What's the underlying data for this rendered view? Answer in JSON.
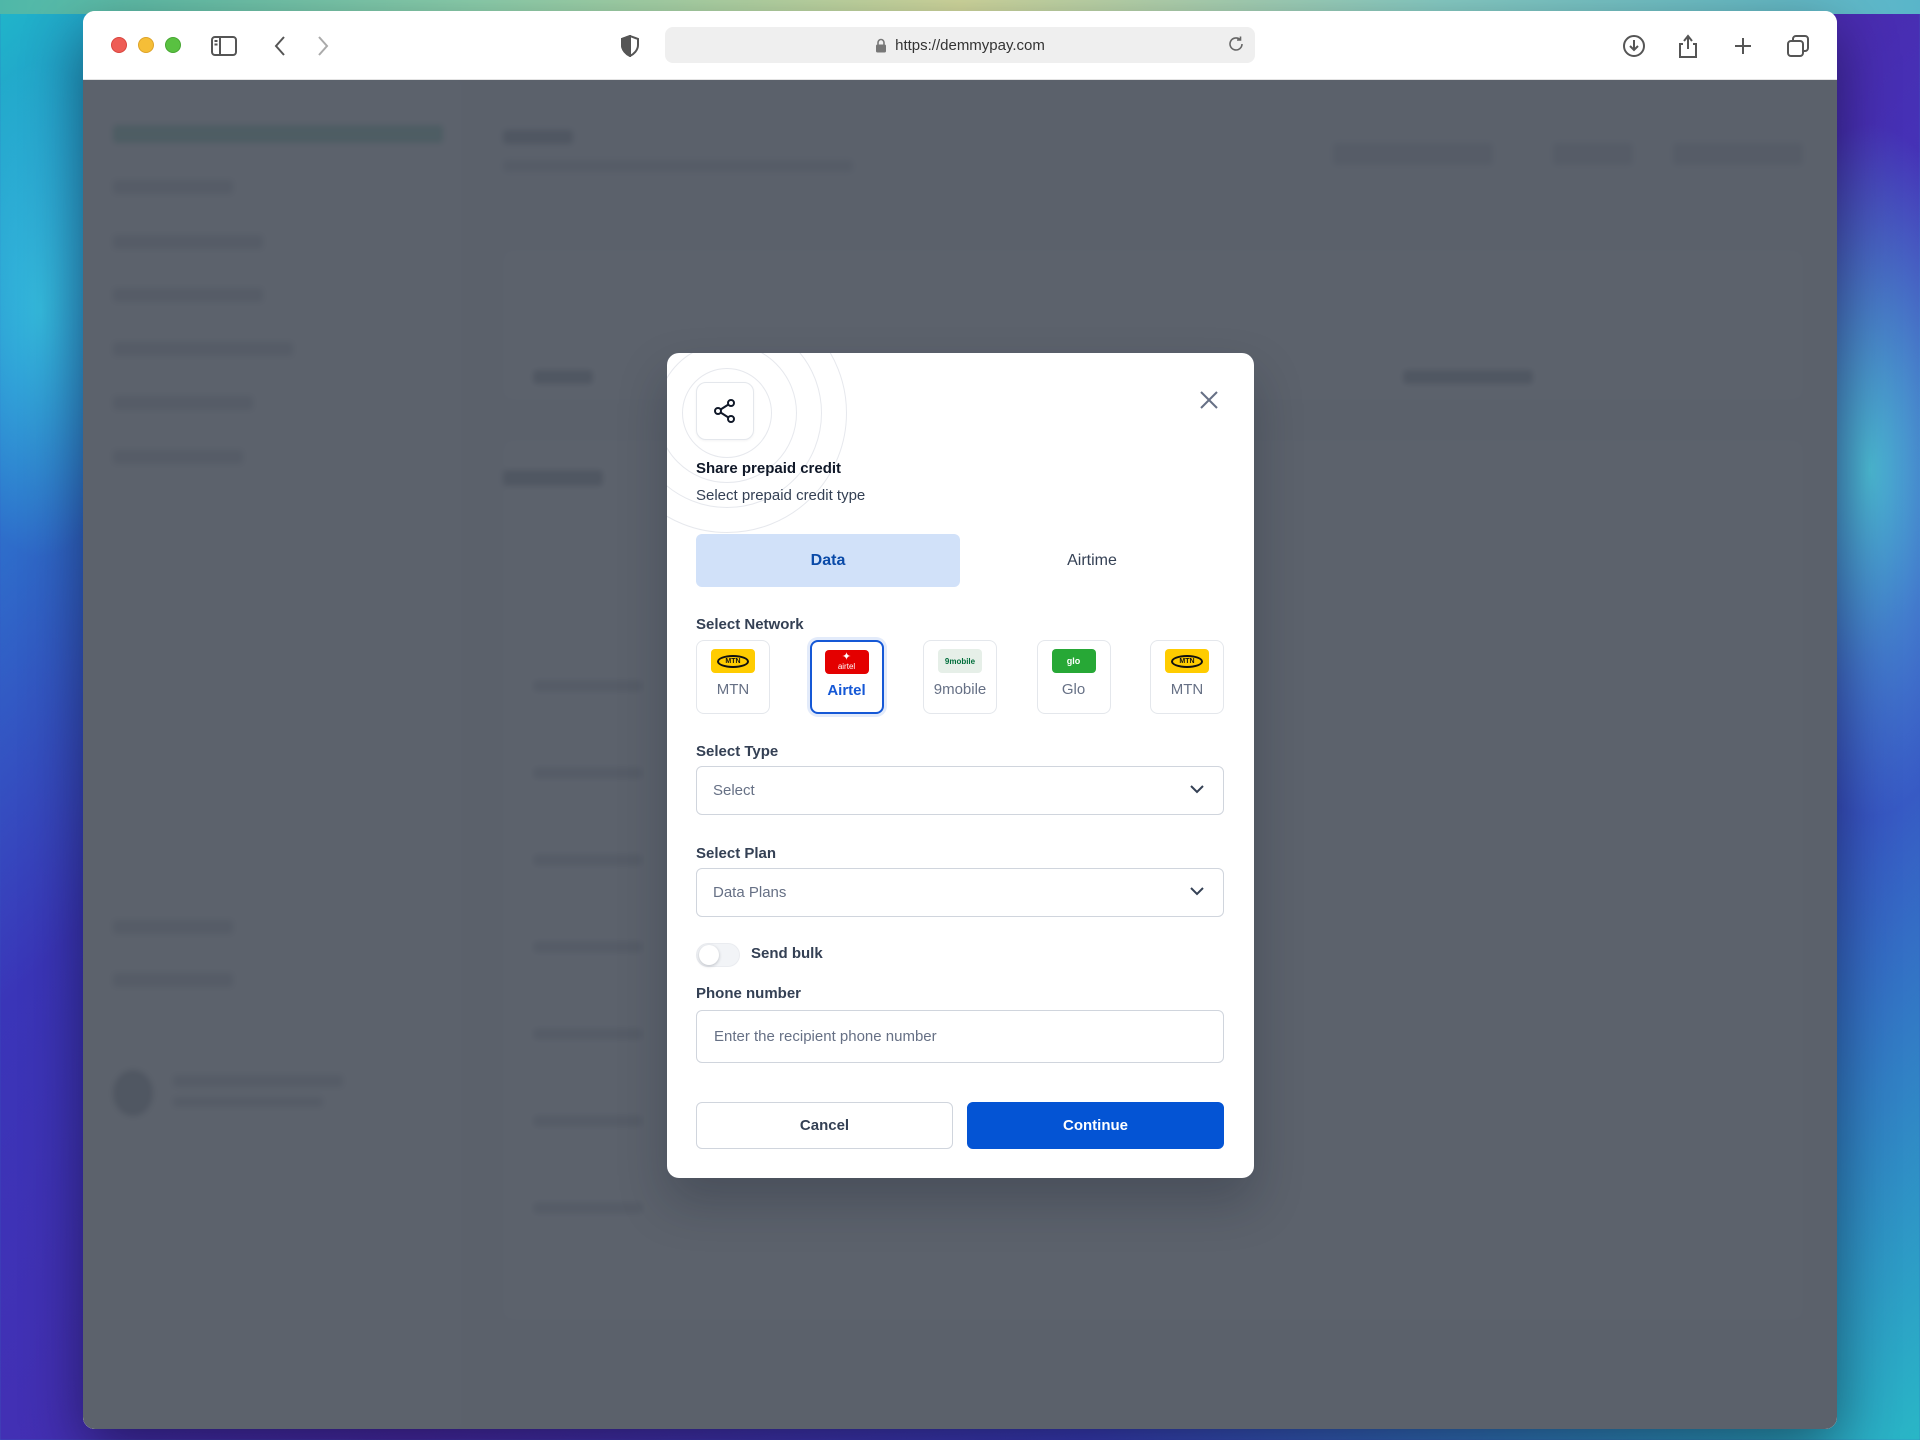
{
  "browser": {
    "url": "https://demmypay.com"
  },
  "modal": {
    "title": "Share prepaid credit",
    "subtitle": "Select prepaid credit type",
    "credit_types": [
      {
        "label": "Data",
        "active": true
      },
      {
        "label": "Airtime",
        "active": false
      }
    ],
    "network_label": "Select Network",
    "networks": [
      {
        "name": "MTN",
        "logo_text": "MTN",
        "color": "#ffcc00",
        "selected": false
      },
      {
        "name": "Airtel",
        "logo_text": "airtel",
        "color": "#e40000",
        "selected": true
      },
      {
        "name": "9mobile",
        "logo_text": "9mobile",
        "color": "#006e3b",
        "selected": false
      },
      {
        "name": "Glo",
        "logo_text": "glo",
        "color": "#27a836",
        "selected": false
      },
      {
        "name": "MTN",
        "logo_text": "MTN",
        "color": "#ffcc00",
        "selected": false
      }
    ],
    "type_label": "Select Type",
    "type_value": "Select",
    "plan_label": "Select Plan",
    "plan_value": "Data Plans",
    "bulk_label": "Send bulk",
    "bulk_enabled": false,
    "phone_label": "Phone number",
    "phone_placeholder": "Enter the recipient phone number",
    "phone_value": "",
    "cancel_label": "Cancel",
    "continue_label": "Continue"
  },
  "colors": {
    "accent": "#0454d4",
    "tab_active_bg": "#d1e1f9",
    "overlay": "rgba(70,76,88,0.88)"
  }
}
